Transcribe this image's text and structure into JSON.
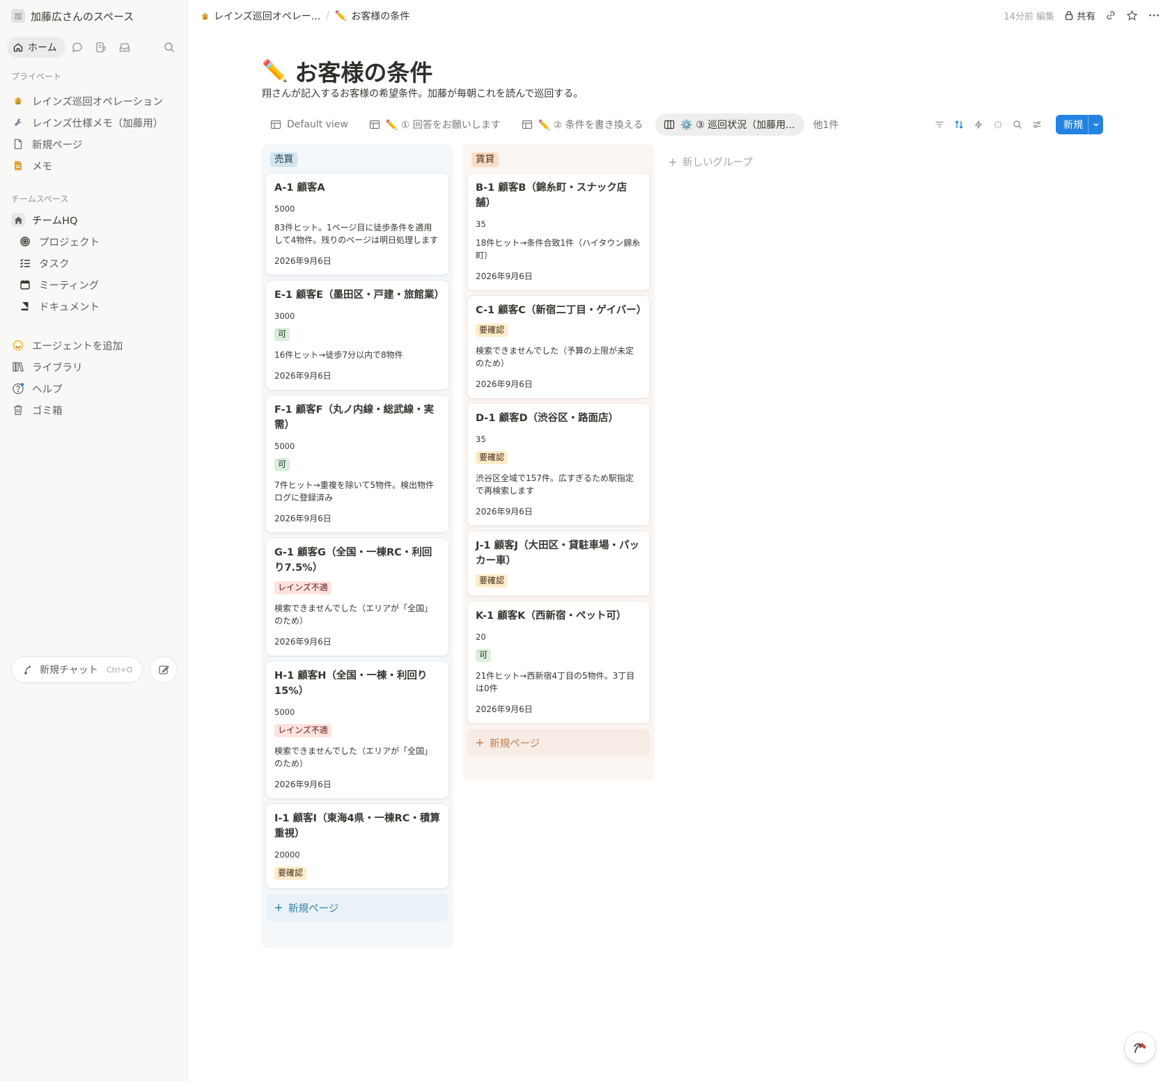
{
  "sidebar": {
    "workspace_initial": "加",
    "workspace_name": "加藤広さんのスペース",
    "home_label": "ホーム",
    "private_label": "プライベート",
    "private_items": [
      {
        "label": "レインズ巡回オペレーション",
        "icon": "house-icon"
      },
      {
        "label": "レインズ仕様メモ（加藤用）",
        "icon": "wrench-icon"
      },
      {
        "label": "新規ページ",
        "icon": "page-icon"
      },
      {
        "label": "メモ",
        "icon": "doc-icon"
      }
    ],
    "team_label": "チームスペース",
    "team_items": [
      {
        "label": "チームHQ",
        "icon": "home-icon"
      },
      {
        "label": "プロジェクト",
        "icon": "target-icon"
      },
      {
        "label": "タスク",
        "icon": "checklist-icon"
      },
      {
        "label": "ミーティング",
        "icon": "calendar-icon"
      },
      {
        "label": "ドキュメント",
        "icon": "document-icon"
      }
    ],
    "util_items": [
      {
        "label": "エージェントを追加",
        "icon": "agent-icon"
      },
      {
        "label": "ライブラリ",
        "icon": "library-icon"
      },
      {
        "label": "ヘルプ",
        "icon": "help-icon"
      },
      {
        "label": "ゴミ箱",
        "icon": "trash-icon"
      }
    ],
    "new_chat_label": "新規チャット",
    "new_chat_shortcut": "Ctrl+O"
  },
  "topbar": {
    "breadcrumb_parent": "レインズ巡回オペレー...",
    "breadcrumb_sep": "/",
    "breadcrumb_current": "お客様の条件",
    "edited": "14分前 編集",
    "share_label": "共有"
  },
  "page": {
    "emoji": "✏️",
    "title": "お客様の条件",
    "description": "翔さんが記入するお客様の希望条件。加藤が毎朝これを読んで巡回する。"
  },
  "views": {
    "tabs": [
      {
        "label": "Default view",
        "active": false
      },
      {
        "label": "✏️ ① 回答をお願いします",
        "active": false
      },
      {
        "label": "✏️ ② 条件を書き換える",
        "active": false
      },
      {
        "label": "⚙️ ③ 巡回状況（加藤用...",
        "active": true
      }
    ],
    "more": "他1件",
    "new_label": "新規"
  },
  "board": {
    "columns": [
      {
        "name": "売買",
        "color": "#d3e5ef",
        "cards": [
          {
            "title": "A-1 顧客A",
            "num": "5000",
            "tag": "",
            "note": "83件ヒット。1ページ目に徒歩条件を適用して4物件。残りのページは明日処理します",
            "date": "2026年9月6日"
          },
          {
            "title": "E-1 顧客E（墨田区・戸建・旅館業）",
            "num": "3000",
            "tag": "可",
            "note": "16件ヒット→徒歩7分以内で8物件",
            "date": "2026年9月6日"
          },
          {
            "title": "F-1 顧客F（丸ノ内線・総武線・実需）",
            "num": "5000",
            "tag": "可",
            "note": "7件ヒット→重複を除いて5物件。検出物件ログに登録済み",
            "date": "2026年9月6日"
          },
          {
            "title": "G-1 顧客G（全国・一棟RC・利回り7.5%）",
            "num": "",
            "tag": "レインズ不適",
            "note": "検索できませんでした（エリアが「全国」のため）",
            "date": "2026年9月6日"
          },
          {
            "title": "H-1 顧客H（全国・一棟・利回り15%）",
            "num": "5000",
            "tag": "レインズ不適",
            "note": "検索できませんでした（エリアが「全国」のため）",
            "date": "2026年9月6日"
          },
          {
            "title": "I-1 顧客I（東海4県・一棟RC・積算重視）",
            "num": "20000",
            "tag": "要確認",
            "note": "",
            "date": ""
          }
        ]
      },
      {
        "name": "賃貸",
        "color": "#fadec9",
        "cards": [
          {
            "title": "B-1 顧客B（錦糸町・スナック店舗）",
            "num": "35",
            "tag": "",
            "note": "18件ヒット→条件合致1件（ハイタウン錦糸町）",
            "date": "2026年9月6日"
          },
          {
            "title": "C-1 顧客C（新宿二丁目・ゲイバー）",
            "num": "",
            "tag": "要確認",
            "note": "検索できませんでした（予算の上限が未定のため）",
            "date": "2026年9月6日"
          },
          {
            "title": "D-1 顧客D（渋谷区・路面店）",
            "num": "35",
            "tag": "要確認",
            "note": "渋谷区全域で157件。広すぎるため駅指定で再検索します",
            "date": "2026年9月6日"
          },
          {
            "title": "J-1 顧客J（大田区・貸駐車場・パッカー車）",
            "num": "",
            "tag": "要確認",
            "note": "",
            "date": ""
          },
          {
            "title": "K-1 顧客K（西新宿・ペット可）",
            "num": "20",
            "tag": "可",
            "note": "21件ヒット→西新宿4丁目の5物件。3丁目は0件",
            "date": "2026年9月6日"
          }
        ]
      }
    ],
    "add_page_label": "新規ページ",
    "new_group_label": "新しいグループ"
  },
  "colors": {
    "accent": "#2383e2",
    "tag_ok": "#dbeddb",
    "tag_check": "#fdecc8",
    "tag_ng": "#ffe2dd"
  }
}
